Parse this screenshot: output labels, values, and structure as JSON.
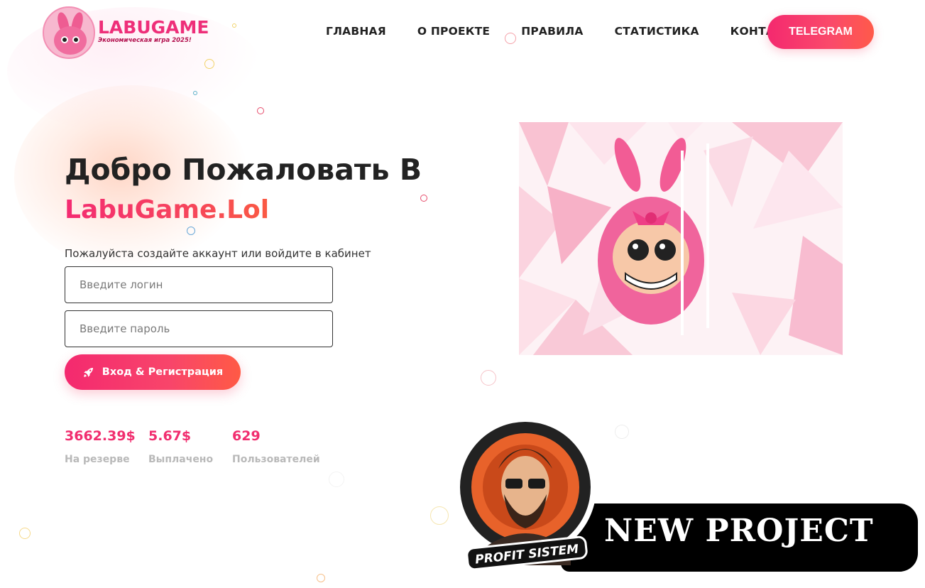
{
  "header": {
    "logo": {
      "title": "LABUGAME",
      "subtitle": "Экономическая игра 2025!"
    },
    "nav": [
      {
        "label": "ГЛАВНАЯ"
      },
      {
        "label": "О ПРОЕКТЕ"
      },
      {
        "label": "ПРАВИЛА"
      },
      {
        "label": "СТАТИСТИКА"
      },
      {
        "label": "КОНТАКТ"
      }
    ],
    "telegram_label": "TELEGRAM"
  },
  "hero": {
    "title": "Добро Пожаловать В",
    "subtitle": "LabuGame.Lol",
    "hint": "Пожалуйста создайте аккаунт или войдите в кабинет",
    "login_placeholder": "Введите логин",
    "password_placeholder": "Введите пароль",
    "login_value": "",
    "password_value": "",
    "submit_label": "Вход & Регистрация",
    "submit_icon": "rocket-icon"
  },
  "stats": [
    {
      "value": "3662.39$",
      "label": "На резерве"
    },
    {
      "value": "5.67$",
      "label": "Выплачено"
    },
    {
      "value": "629",
      "label": "Пользователей"
    }
  ],
  "promo": {
    "text": "NEW PROJECT",
    "badge_text": "PROFIT SISTEM"
  },
  "colors": {
    "accent_pink": "#f42b72",
    "accent_orange": "#ff5a45",
    "stat_label": "#b9b9b9",
    "text_dark": "#222222"
  }
}
